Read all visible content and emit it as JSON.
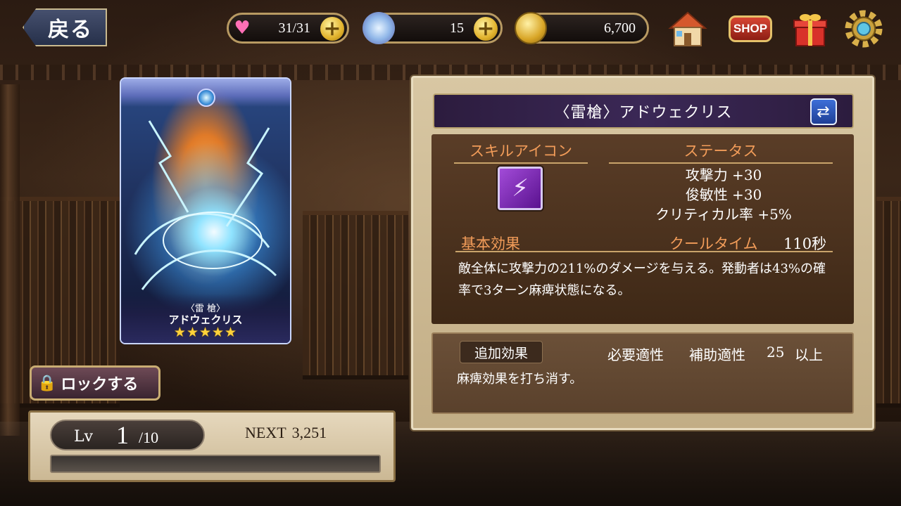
{
  "top_bar": {
    "back_label": "戻る",
    "stamina": "31/31",
    "gems": "15",
    "gold": "6,700",
    "shop_label": "SHOP"
  },
  "card": {
    "epithet": "〈雷 槍〉",
    "name": "アドウェクリス",
    "stars": "★★★★★",
    "rarity": 5
  },
  "lock": {
    "label": "ロックする"
  },
  "level": {
    "label": "Lv",
    "current": "1",
    "max": "/10",
    "next_label": "NEXT",
    "next_value": "3,251",
    "progress": 0
  },
  "skill": {
    "title": "〈雷槍〉アドウェクリス",
    "icon_header": "スキルアイコン",
    "status_header": "ステータス",
    "stats": [
      "攻撃力 +30",
      "俊敏性 +30",
      "クリティカル率 +5%"
    ],
    "basic_label": "基本効果",
    "cooldown_label": "クールタイム",
    "cooldown_value": "110秒",
    "description": "敵全体に攻撃力の211%のダメージを与える。発動者は43%の確率で3ターン麻痺状態になる。"
  },
  "extra": {
    "tag": "追加効果",
    "req_label": "必要適性",
    "req_type": "補助適性",
    "req_value": "25",
    "req_suffix": "以上",
    "description": "麻痺効果を打ち消す。"
  },
  "colors": {
    "accent_orange": "#f29c59",
    "title_purple": "#3b2856",
    "gold_plus": "#e1b22c"
  }
}
